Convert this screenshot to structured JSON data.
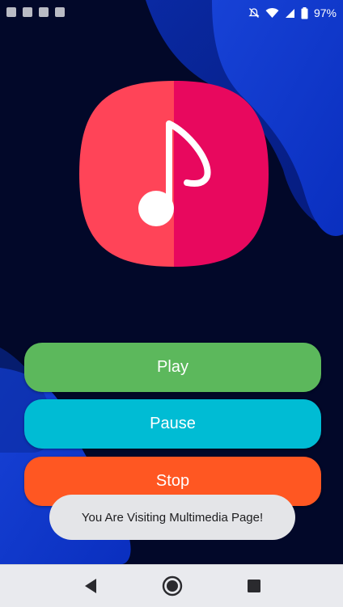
{
  "status_bar": {
    "time": "",
    "battery_percent": "97%",
    "icons_left": [
      "notification-icon",
      "notification-icon",
      "notification-icon",
      "notification-icon"
    ],
    "icons_right": [
      "mute-icon",
      "wifi-icon",
      "signal-icon",
      "battery-icon"
    ]
  },
  "app_icon": {
    "icon": "music-note-icon",
    "colors": {
      "left": "#ff4458",
      "right": "#e8085e",
      "note": "#ffffff"
    }
  },
  "buttons": {
    "play": {
      "label": "Play",
      "color": "#5cb85c"
    },
    "pause": {
      "label": "Pause",
      "color": "#00bcd4"
    },
    "stop": {
      "label": "Stop",
      "color": "#ff5722"
    }
  },
  "toast": {
    "message": "You Are Visiting Multimedia Page!"
  },
  "nav_bar": {
    "back_icon": "back-triangle-icon",
    "home_icon": "home-circle-icon",
    "recents_icon": "recents-square-icon"
  },
  "colors": {
    "background": "#020829",
    "accent_blue": "#0b43e0"
  }
}
